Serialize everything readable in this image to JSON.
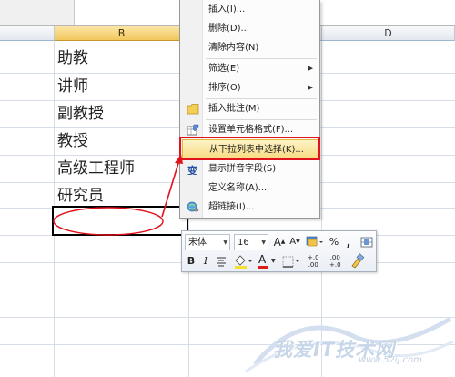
{
  "sheet": {
    "col_b": "B",
    "col_d": "D",
    "cells": [
      "助教",
      "讲师",
      "副教授",
      "教授",
      "高级工程师",
      "研究员"
    ]
  },
  "context_menu": {
    "items": [
      {
        "label": "插入(I)...",
        "icon": "insert-icon"
      },
      {
        "label": "删除(D)...",
        "icon": ""
      },
      {
        "label": "清除内容(N)",
        "icon": ""
      },
      {
        "label": "筛选(E)",
        "submenu": true
      },
      {
        "label": "排序(O)",
        "submenu": true
      },
      {
        "label": "插入批注(M)",
        "icon": "comment-icon"
      },
      {
        "label": "设置单元格格式(F)...",
        "icon": "format-cells-icon"
      },
      {
        "label": "从下拉列表中选择(K)...",
        "icon": "",
        "highlighted": true
      },
      {
        "label": "显示拼音字段(S)",
        "icon": "phonetic-icon"
      },
      {
        "label": "定义名称(A)...",
        "icon": ""
      },
      {
        "label": "超链接(I)...",
        "icon": "hyperlink-icon"
      }
    ]
  },
  "mini_toolbar": {
    "font_name": "宋体",
    "font_size": "16",
    "grow_font": "A",
    "shrink_font": "A",
    "percent": "%",
    "comma": ",",
    "bold": "B",
    "italic": "I",
    "font_color_glyph": "A",
    "inc_decimal": "+.0\n.00",
    "dec_decimal": ".00\n+.0"
  },
  "watermark": {
    "text": "我爱IT技术网",
    "url": "www.52ij.com"
  },
  "colors": {
    "highlight_red": "#e1121b",
    "menu_hover": "#f8dd86",
    "header_selected": "#f3c65e"
  }
}
